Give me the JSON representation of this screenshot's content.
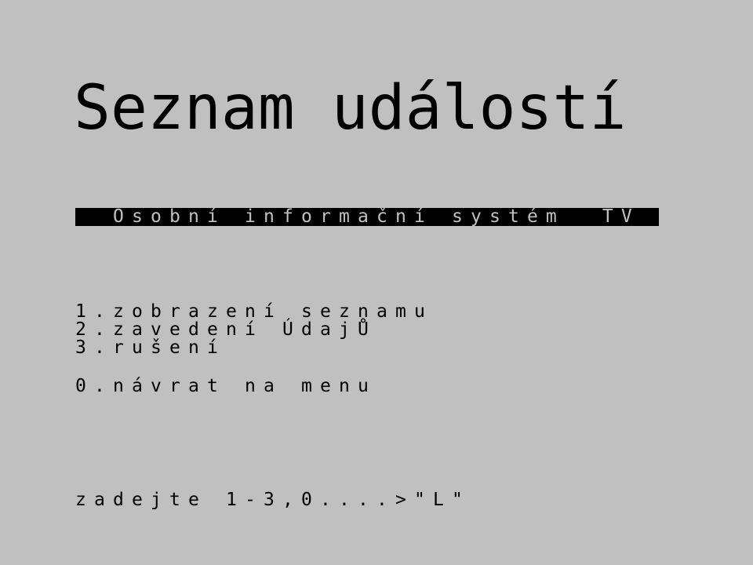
{
  "colors": {
    "paper": "#c0c0c0",
    "ink": "#000000"
  },
  "title": "Seznam událostí",
  "banner": {
    "text": "Osobní informační systém  TV"
  },
  "menu": {
    "items": [
      "1.zobrazení seznamu",
      "2.zavedení ÚdajŮ",
      "3.rušení"
    ],
    "back": "0.návrat na menu"
  },
  "prompt": {
    "text": "zadejte 1-3,0....>",
    "cursor": "\"L\""
  }
}
